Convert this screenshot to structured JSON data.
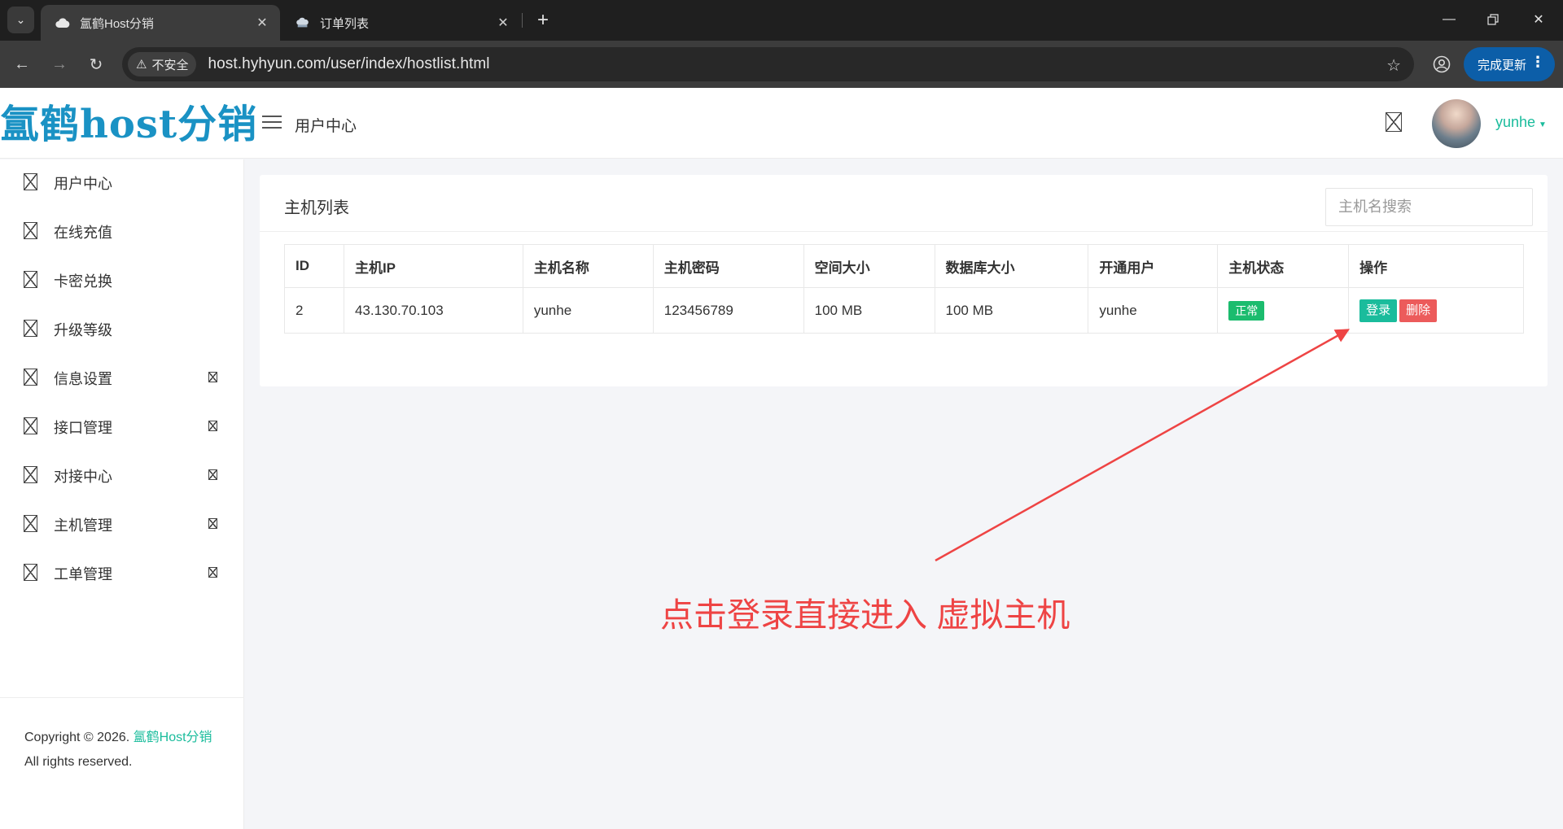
{
  "browser": {
    "tabs": [
      {
        "title": "氲鹤Host分销",
        "active": true
      },
      {
        "title": "订单列表",
        "active": false
      }
    ],
    "security_label": "不安全",
    "url": "host.hyhyun.com/user/index/hostlist.html",
    "update_label": "完成更新"
  },
  "header": {
    "logo": "氲鹤host分销",
    "title": "用户中心",
    "username": "yunhe"
  },
  "sidebar": {
    "items": [
      {
        "label": "用户中心",
        "has_submenu": false
      },
      {
        "label": "在线充值",
        "has_submenu": false
      },
      {
        "label": "卡密兑换",
        "has_submenu": false
      },
      {
        "label": "升级等级",
        "has_submenu": false
      },
      {
        "label": "信息设置",
        "has_submenu": true
      },
      {
        "label": "接口管理",
        "has_submenu": true
      },
      {
        "label": "对接中心",
        "has_submenu": true
      },
      {
        "label": "主机管理",
        "has_submenu": true
      },
      {
        "label": "工单管理",
        "has_submenu": true
      }
    ],
    "copyright_prefix": "Copyright © 2026.",
    "copyright_brand": "氲鹤Host分销",
    "copyright_suffix": "All rights reserved."
  },
  "main": {
    "card_title": "主机列表",
    "search_placeholder": "主机名搜索",
    "columns": [
      "ID",
      "主机IP",
      "主机名称",
      "主机密码",
      "空间大小",
      "数据库大小",
      "开通用户",
      "主机状态",
      "操作"
    ],
    "rows": [
      {
        "id": "2",
        "ip": "43.130.70.103",
        "name": "yunhe",
        "password": "123456789",
        "space": "100 MB",
        "db_size": "100 MB",
        "user": "yunhe",
        "status": "正常",
        "actions": {
          "login": "登录",
          "delete": "删除"
        }
      }
    ]
  },
  "annotation": {
    "text": "点击登录直接进入 虚拟主机",
    "color": "#ee4444"
  },
  "colors": {
    "accent": "#1abc9c",
    "danger": "#ec5b5b",
    "status_ok": "#1bbc6e",
    "logo": "#1a92c4",
    "update_button": "#0c5ea8"
  }
}
